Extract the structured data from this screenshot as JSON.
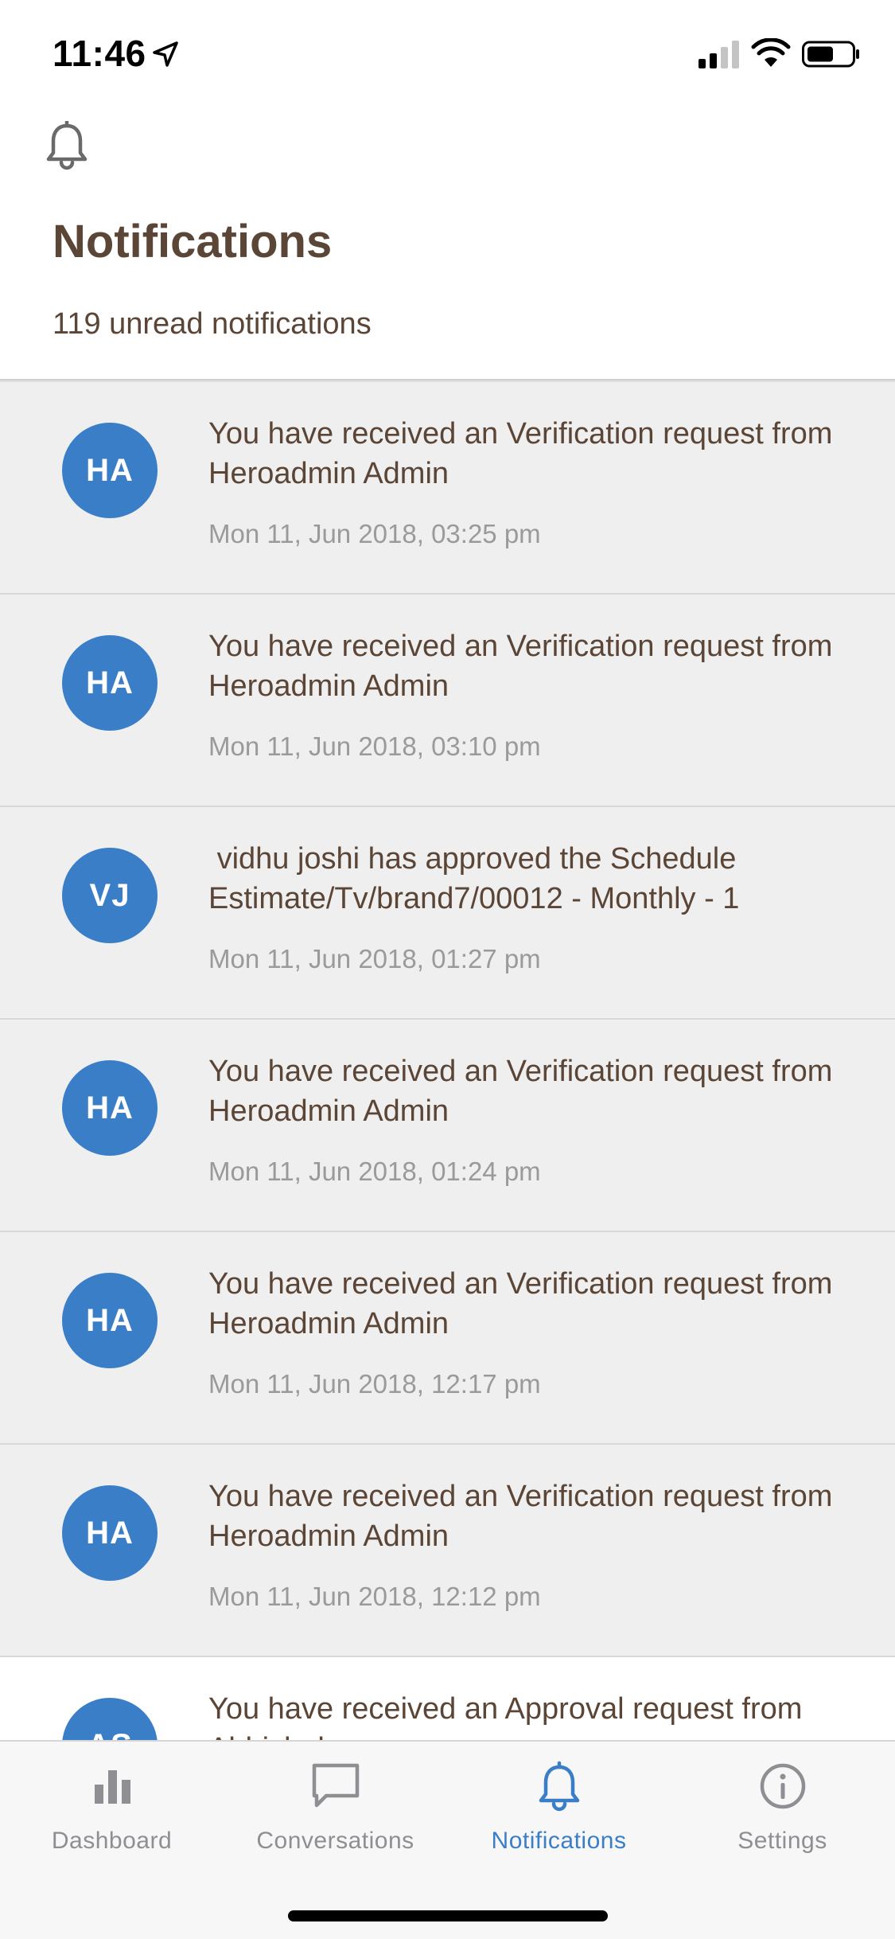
{
  "status_bar": {
    "time": "11:46"
  },
  "header": {
    "title": "Notifications",
    "unread_text": "119 unread notifications"
  },
  "notifications": [
    {
      "initials": "HA",
      "message": "You have received an Verification request from Heroadmin Admin",
      "time": "Mon 11, Jun 2018, 03:25 pm",
      "unread": true
    },
    {
      "initials": "HA",
      "message": "You have received an Verification request from Heroadmin Admin",
      "time": "Mon 11, Jun 2018, 03:10 pm",
      "unread": true
    },
    {
      "initials": "VJ",
      "message": " vidhu joshi has approved the Schedule Estimate/Tv/brand7/00012 - Monthly - 1",
      "time": "Mon 11, Jun 2018, 01:27 pm",
      "unread": true
    },
    {
      "initials": "HA",
      "message": "You have received an Verification request from Heroadmin Admin",
      "time": "Mon 11, Jun 2018, 01:24 pm",
      "unread": true
    },
    {
      "initials": "HA",
      "message": "You have received an Verification request from Heroadmin Admin",
      "time": "Mon 11, Jun 2018, 12:17 pm",
      "unread": true
    },
    {
      "initials": "HA",
      "message": "You have received an Verification request from Heroadmin Admin",
      "time": "Mon 11, Jun 2018, 12:12 pm",
      "unread": true
    },
    {
      "initials": "AS",
      "message": "You have received an Approval request from Abhishek",
      "time": "",
      "unread": false
    }
  ],
  "tabs": [
    {
      "label": "Dashboard",
      "icon": "bar-chart-icon",
      "active": false
    },
    {
      "label": "Conversations",
      "icon": "chat-bubble-icon",
      "active": false
    },
    {
      "label": "Notifications",
      "icon": "bell-icon",
      "active": true
    },
    {
      "label": "Settings",
      "icon": "info-icon",
      "active": false
    }
  ],
  "colors": {
    "accent": "#3a7ec8",
    "title_text": "#5b4536",
    "secondary_text": "#9a9a9a",
    "unread_row_bg": "#efefef",
    "inactive_tab": "#8e8e93"
  }
}
